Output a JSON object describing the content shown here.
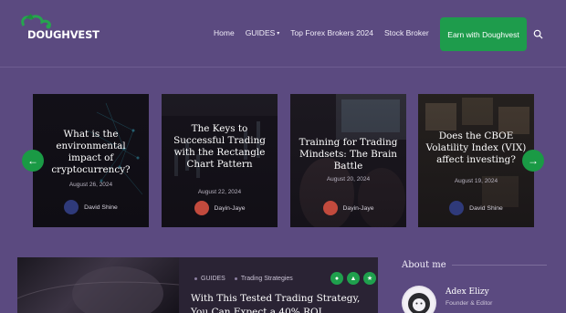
{
  "brand": {
    "name": "DOUGHVEST"
  },
  "nav": {
    "items": [
      "Home",
      "GUIDES",
      "Top Forex Brokers 2024",
      "Stock Broker"
    ],
    "cta": "Earn with Doughvest",
    "search_icon": "search-icon"
  },
  "slider": {
    "prev_icon": "arrow-left-icon",
    "next_icon": "arrow-right-icon",
    "cards": [
      {
        "title": "What is the environmental impact of cryptocurrency?",
        "date": "August 26, 2024",
        "author": "David Shine"
      },
      {
        "title": "The Keys to Successful Trading with the Rectangle Chart Pattern",
        "date": "August 22, 2024",
        "author": "Dayin-Jaye"
      },
      {
        "title": "Training for Trading Mindsets: The Brain Battle",
        "date": "August 20, 2024",
        "author": "Dayin-Jaye"
      },
      {
        "title": "Does the CBOE Volatility Index (VIX) affect investing?",
        "date": "August 19, 2024",
        "author": "David Shine"
      }
    ]
  },
  "featured": {
    "category": "GUIDES",
    "tag": "Trading Strategies",
    "title_line1": "With This Tested Trading Strategy,",
    "title_line2": "You Can Expect a 40% ROI"
  },
  "about": {
    "heading": "About me",
    "name": "Adex Elizy",
    "role": "Founder & Editor"
  },
  "colors": {
    "background": "#5b4a80",
    "accent": "#1e9c4c"
  }
}
